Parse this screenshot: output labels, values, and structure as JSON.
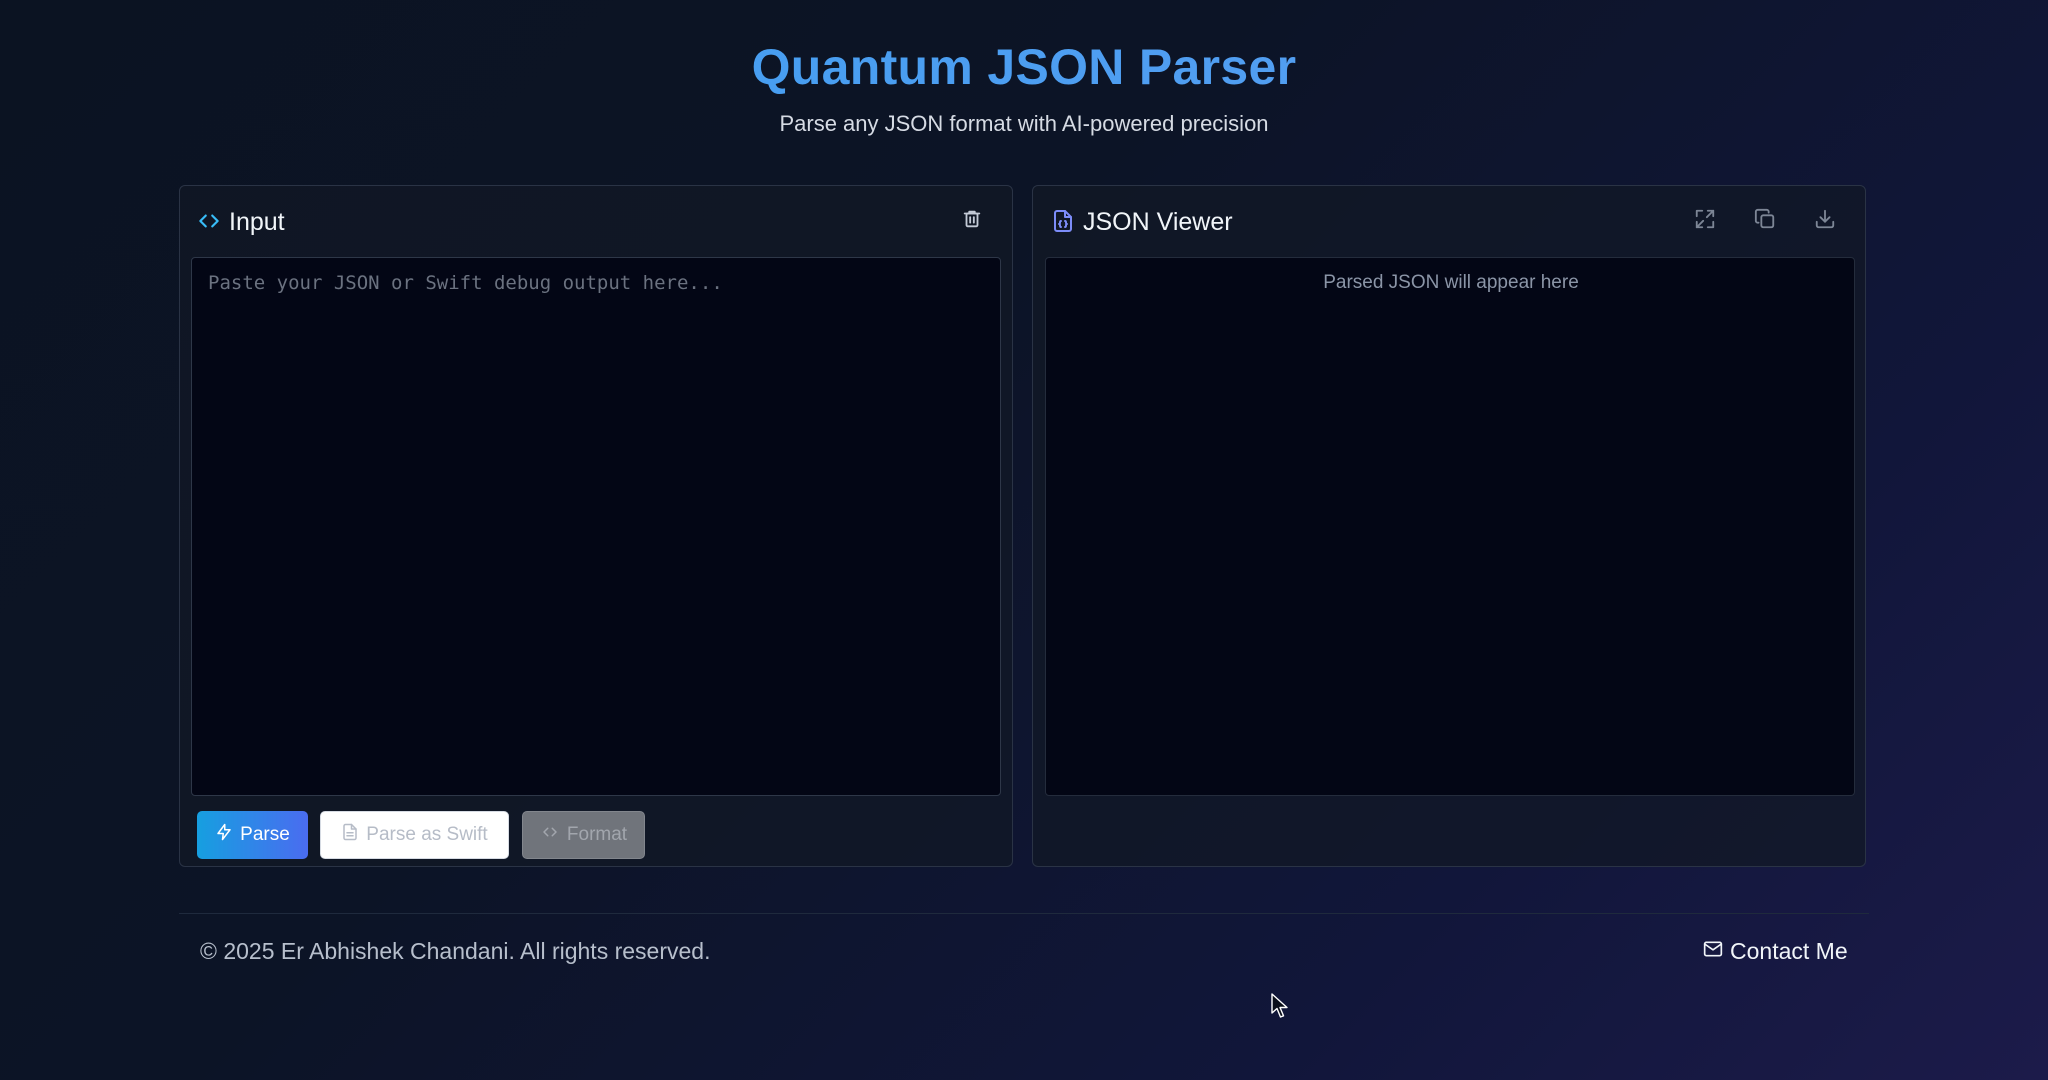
{
  "header": {
    "title": "Quantum JSON Parser",
    "subtitle": "Parse any JSON format with AI-powered precision"
  },
  "input_panel": {
    "title": "Input",
    "title_icon": "code-brackets-icon",
    "clear_icon": "trash-icon",
    "textarea": {
      "value": "",
      "placeholder": "Paste your JSON or Swift debug output here..."
    },
    "buttons": {
      "parse_label": "Parse",
      "parse_icon": "lightning-icon",
      "parse_swift_label": "Parse as Swift",
      "parse_swift_icon": "document-icon",
      "format_label": "Format",
      "format_icon": "code-brackets-icon"
    }
  },
  "viewer_panel": {
    "title": "JSON Viewer",
    "title_icon": "json-file-icon",
    "placeholder": "Parsed JSON will appear here",
    "tools": [
      "expand-icon",
      "copy-icon",
      "download-icon"
    ]
  },
  "footer": {
    "copyright": "© 2025 Er Abhishek Chandani. All rights reserved.",
    "contact_label": "Contact Me",
    "contact_icon": "mail-icon"
  },
  "colors": {
    "title": "#4fa3f0",
    "accent_start": "#169fe0",
    "accent_end": "#4a6cf0",
    "background": "#0c1426",
    "panel": "#121826",
    "editor": "#030615"
  }
}
